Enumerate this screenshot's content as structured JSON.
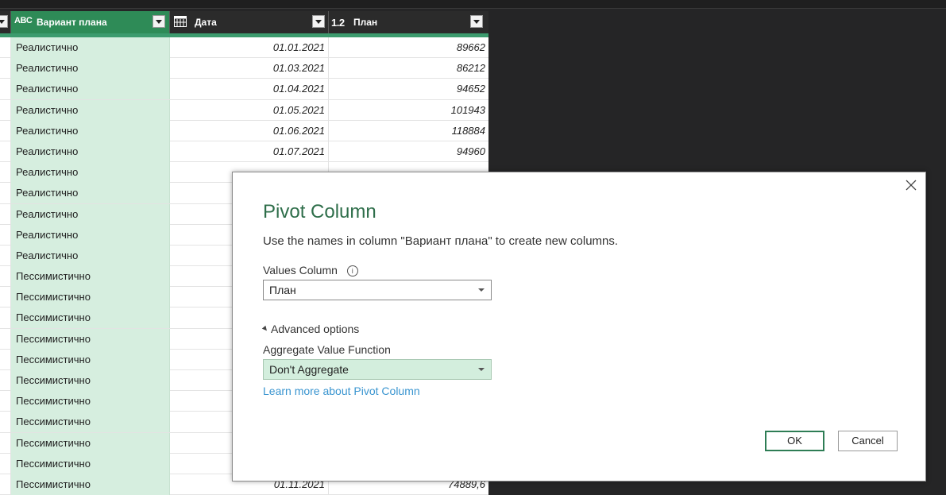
{
  "grid": {
    "columns": [
      {
        "type_icon": "ABC",
        "name": "Вариант плана"
      },
      {
        "type_icon": "calendar-icon",
        "name": "Дата"
      },
      {
        "type_icon": "1.2",
        "name": "План"
      }
    ],
    "rows": [
      {
        "variant": "Реалистично",
        "date": "01.01.2021",
        "plan": "89662"
      },
      {
        "variant": "Реалистично",
        "date": "01.03.2021",
        "plan": "86212"
      },
      {
        "variant": "Реалистично",
        "date": "01.04.2021",
        "plan": "94652"
      },
      {
        "variant": "Реалистично",
        "date": "01.05.2021",
        "plan": "101943"
      },
      {
        "variant": "Реалистично",
        "date": "01.06.2021",
        "plan": "118884"
      },
      {
        "variant": "Реалистично",
        "date": "01.07.2021",
        "plan": "94960"
      },
      {
        "variant": "Реалистично",
        "date": "",
        "plan": ""
      },
      {
        "variant": "Реалистично",
        "date": "",
        "plan": ""
      },
      {
        "variant": "Реалистично",
        "date": "",
        "plan": ""
      },
      {
        "variant": "Реалистично",
        "date": "",
        "plan": ""
      },
      {
        "variant": "Реалистично",
        "date": "",
        "plan": ""
      },
      {
        "variant": "Пессимистично",
        "date": "",
        "plan": ""
      },
      {
        "variant": "Пессимистично",
        "date": "",
        "plan": ""
      },
      {
        "variant": "Пессимистично",
        "date": "",
        "plan": ""
      },
      {
        "variant": "Пессимистично",
        "date": "",
        "plan": ""
      },
      {
        "variant": "Пессимистично",
        "date": "",
        "plan": ""
      },
      {
        "variant": "Пессимистично",
        "date": "",
        "plan": ""
      },
      {
        "variant": "Пессимистично",
        "date": "",
        "plan": ""
      },
      {
        "variant": "Пессимистично",
        "date": "",
        "plan": ""
      },
      {
        "variant": "Пессимистично",
        "date": "",
        "plan": ""
      },
      {
        "variant": "Пессимистично",
        "date": "",
        "plan": ""
      },
      {
        "variant": "Пессимистично",
        "date": "01.11.2021",
        "plan": "74889,6"
      }
    ]
  },
  "dialog": {
    "title": "Pivot Column",
    "description": "Use the names in column \"Вариант плана\" to create new columns.",
    "values_column_label": "Values Column",
    "values_column_value": "План",
    "advanced_options_label": "Advanced options",
    "aggregate_label": "Aggregate Value Function",
    "aggregate_value": "Don't Aggregate",
    "learn_more": "Learn more about Pivot Column",
    "ok_label": "OK",
    "cancel_label": "Cancel"
  },
  "colors": {
    "accent": "#3c9b6e",
    "selected_column_fill": "#d6eedf",
    "dialog_title": "#2e6e4a",
    "link": "#3a95d0"
  }
}
